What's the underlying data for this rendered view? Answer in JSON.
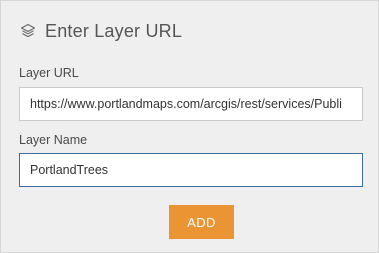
{
  "header": {
    "title": "Enter Layer URL",
    "icon": "layers-icon"
  },
  "form": {
    "url_label": "Layer URL",
    "url_value": "https://www.portlandmaps.com/arcgis/rest/services/Publi",
    "name_label": "Layer Name",
    "name_value": "PortlandTrees",
    "add_label": "ADD"
  },
  "colors": {
    "panel_bg": "#efefef",
    "button_accent": "#ea9433",
    "focus_border": "#3a6e9e"
  }
}
